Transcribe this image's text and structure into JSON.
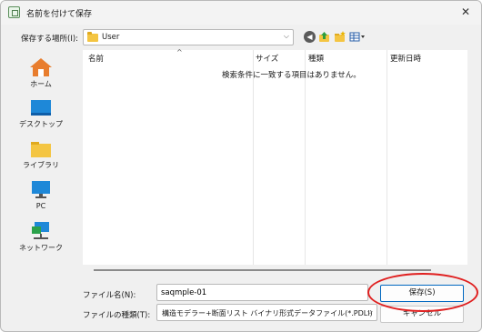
{
  "window": {
    "title": "名前を付けて保存",
    "close_glyph": "✕"
  },
  "location": {
    "label": "保存する場所(I):",
    "value": "User",
    "arrow": "⌵"
  },
  "toolbar": {
    "back_icon": "back-arrow-icon",
    "up_icon": "up-folder-icon",
    "new_folder_icon": "new-folder-icon",
    "view_icon": "view-menu-icon"
  },
  "places": [
    {
      "label": "ホーム",
      "icon": "home-icon"
    },
    {
      "label": "デスクトップ",
      "icon": "desktop-icon"
    },
    {
      "label": "ライブラリ",
      "icon": "library-icon"
    },
    {
      "label": "PC",
      "icon": "pc-icon"
    },
    {
      "label": "ネットワーク",
      "icon": "network-icon"
    }
  ],
  "filelist": {
    "columns": [
      "名前",
      "サイズ",
      "種類",
      "更新日時"
    ],
    "empty_message": "検索条件に一致する項目はありません。"
  },
  "form": {
    "filename_label": "ファイル名(N):",
    "filename_value": "saqmple-01",
    "save_label": "保存(S)",
    "filetype_label": "ファイルの種類(T):",
    "filetype_value": "構造モデラー+断面リスト バイナリ形式データファイル(*.PDLI)",
    "filetype_arrow": "⌵",
    "cancel_label": "キャンセル"
  },
  "colors": {
    "accent": "#0067c0",
    "highlight": "#e02020",
    "folder": "#f4c542"
  }
}
